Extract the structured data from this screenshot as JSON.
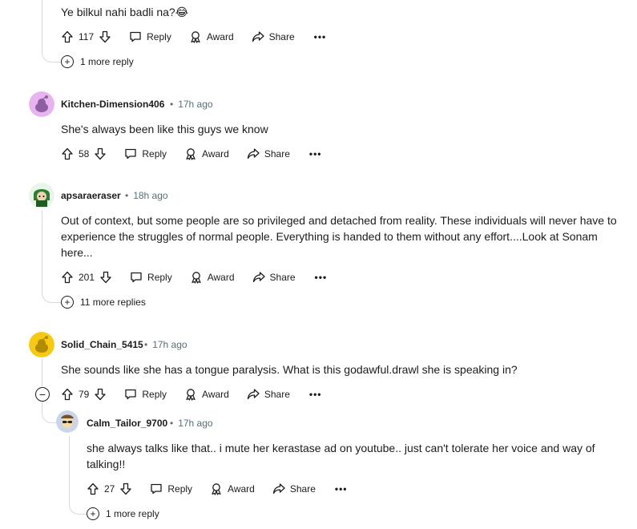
{
  "labels": {
    "reply": "Reply",
    "award": "Award",
    "share": "Share",
    "more": "•••",
    "dot": "•"
  },
  "comments": [
    {
      "body": "Ye bilkul nahi badli na?😂",
      "votes": "117",
      "more_replies": "1 more reply"
    },
    {
      "username": "Kitchen-Dimension406",
      "time": "17h ago",
      "body": "She's always been like this guys we know",
      "votes": "58",
      "avatar_color": "#e7b4f0"
    },
    {
      "username": "apsaraeraser",
      "time": "18h ago",
      "body": "Out of context, but some people are so privileged and detached from reality. These individuals will never have to experience the struggles of normal people. Everything is handed to them without any effort....Look at Sonam here...",
      "votes": "201",
      "more_replies": "11 more replies",
      "avatar_color": "#2e7d32"
    },
    {
      "username": "Solid_Chain_5415",
      "time": "17h ago",
      "body": "She sounds like she has a tongue paralysis. What is this godawful.drawl she is speaking in?",
      "votes": "79",
      "collapse": "−",
      "avatar_color": "#f6c915"
    },
    {
      "username": "Calm_Tailor_9700",
      "time": "17h ago",
      "body": "she always talks like that.. i mute her kerastase ad on youtube.. just can't tolerate her voice and way of talking!!",
      "votes": "27",
      "more_replies": "1 more reply",
      "avatar_color": "#c9d6e8"
    }
  ],
  "more_replies_icon": "+"
}
